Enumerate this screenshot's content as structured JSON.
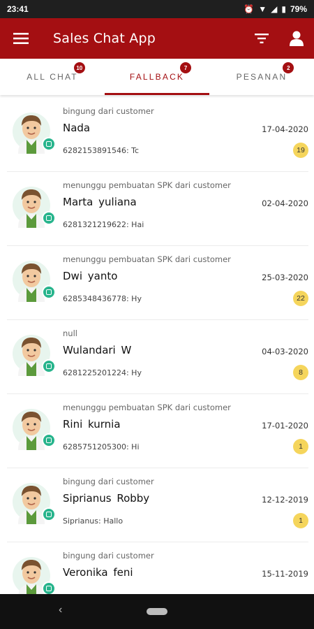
{
  "status_bar": {
    "time": "23:41",
    "battery": "79%"
  },
  "app_bar": {
    "title": "Sales Chat App"
  },
  "tabs": [
    {
      "label": "ALL CHAT",
      "badge": "10",
      "active": false
    },
    {
      "label": "FALLBACK",
      "badge": "7",
      "active": true
    },
    {
      "label": "PESANAN",
      "badge": "2",
      "active": false
    }
  ],
  "chats": [
    {
      "status": "bingung dari customer",
      "name": "Nada",
      "date": "17-04-2020",
      "preview": "6282153891546: Tc",
      "count": "19"
    },
    {
      "status": "menunggu pembuatan SPK dari customer",
      "name": "Marta yuliana",
      "date": "02-04-2020",
      "preview": "6281321219622: Hai",
      "count": ""
    },
    {
      "status": "menunggu pembuatan SPK dari customer",
      "name": "Dwi yanto",
      "date": "25-03-2020",
      "preview": "6285348436778: Hy",
      "count": "22"
    },
    {
      "status": "null",
      "name": "Wulandari W",
      "date": "04-03-2020",
      "preview": "6281225201224: Hy",
      "count": "8"
    },
    {
      "status": "menunggu pembuatan SPK dari customer",
      "name": "Rini kurnia",
      "date": "17-01-2020",
      "preview": "6285751205300: Hi",
      "count": "1"
    },
    {
      "status": "bingung dari customer",
      "name": "Siprianus Robby",
      "date": "12-12-2019",
      "preview": "Siprianus: Hallo",
      "count": "1"
    },
    {
      "status": "bingung dari customer",
      "name": "Veronika feni",
      "date": "15-11-2019",
      "preview": "",
      "count": ""
    }
  ],
  "colors": {
    "primary": "#a40f12",
    "badge_count": "#f5d55c",
    "chat_badge": "#27b48c"
  }
}
